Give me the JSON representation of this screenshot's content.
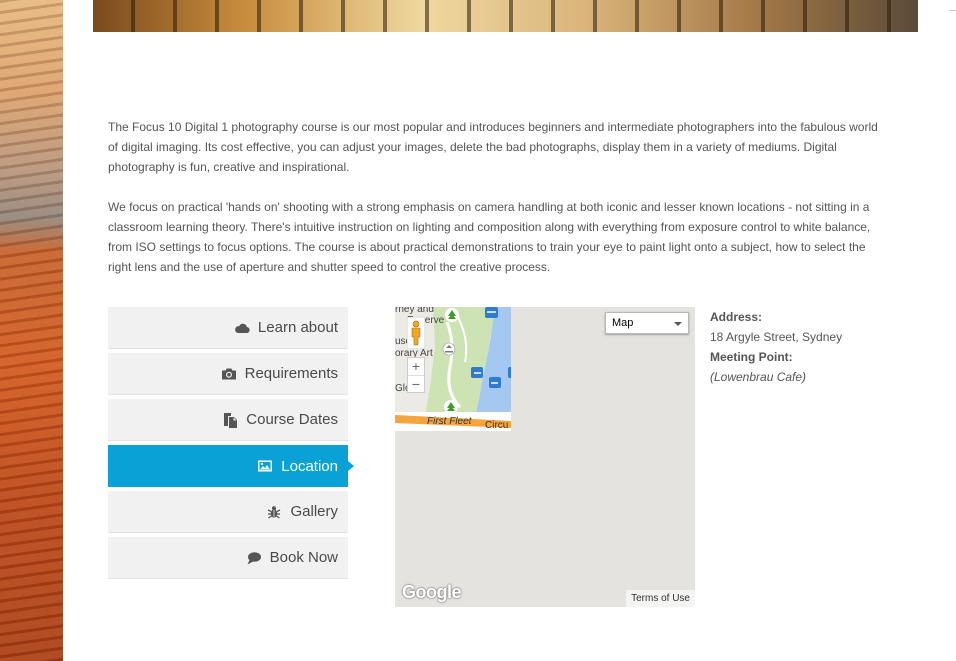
{
  "intro": {
    "paragraph1": "The Focus 10 Digital 1 photography course is our most popular and introduces beginners and intermediate photographers into the fabulous world of digital imaging. Its cost effective, you can adjust your images, delete the bad photographs, display them in a variety of mediums. Digital photography is fun, creative and inspirational.",
    "paragraph2": "We focus on practical 'hands on' shooting with a strong emphasis on camera handling at both iconic and lesser known locations - not sitting in a classroom learning theory. There's intuitive instruction on lighting and composition along with everything from exposure control to white balance, from ISO settings to focus options. The course is about practical demonstrations to train your eye to paint light onto a subject, how to select the right lens and the use of aperture and shutter speed to control the creative process."
  },
  "tabs": [
    {
      "label": "Learn about",
      "icon": "cloud-icon",
      "active": false
    },
    {
      "label": "Requirements",
      "icon": "camera-icon",
      "active": false
    },
    {
      "label": "Course Dates",
      "icon": "copy-icon",
      "active": false
    },
    {
      "label": "Location",
      "icon": "image-icon",
      "active": true
    },
    {
      "label": "Gallery",
      "icon": "bug-icon",
      "active": false
    },
    {
      "label": "Book Now",
      "icon": "comment-icon",
      "active": false
    }
  ],
  "map": {
    "type_selected": "Map",
    "labels": {
      "label1": "rney and",
      "label2": "Reserve",
      "label3": "use of",
      "label4": "orary Art",
      "label5": "Global",
      "street": "First Fleet",
      "circ": "Circu"
    },
    "zoom_in": "+",
    "zoom_out": "−",
    "logo": "Google",
    "terms": "Terms of Use"
  },
  "address": {
    "address_label": "Address:",
    "address_value": "18 Argyle Street, Sydney",
    "meeting_label": "Meeting Point:",
    "meeting_value": "(Lowenbrau Cafe)"
  },
  "colors": {
    "accent": "#0aa2d6",
    "tab_bg": "#f1f1f1",
    "text": "#555555"
  }
}
